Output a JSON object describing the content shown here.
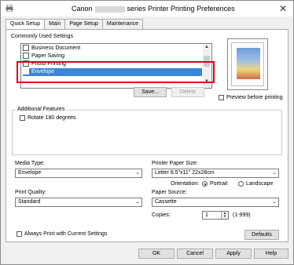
{
  "window": {
    "title_prefix": "Canon",
    "title_suffix": "series Printer Printing Preferences",
    "close": "✕"
  },
  "tabs": [
    {
      "label": "Quick Setup"
    },
    {
      "label": "Main"
    },
    {
      "label": "Page Setup"
    },
    {
      "label": "Maintenance"
    }
  ],
  "commonly_used": {
    "label": "Commonly Used Settings",
    "items": [
      "Business Document",
      "Paper Saving",
      "Photo Printing",
      "Envelope"
    ],
    "selected": "Envelope",
    "save_label": "Save...",
    "delete_label": "Delete"
  },
  "preview": {
    "checkbox_label": "Preview before printing"
  },
  "additional_features": {
    "label": "Additional Features",
    "rotate_label": "Rotate 180 degrees"
  },
  "media_type": {
    "label": "Media Type:",
    "value": "Envelope"
  },
  "printer_paper_size": {
    "label": "Printer Paper Size:",
    "value": "Letter 8.5\"x11\" 22x28cm"
  },
  "orientation": {
    "label": "Orientation:",
    "portrait": "Portrait",
    "landscape": "Landscape"
  },
  "print_quality": {
    "label": "Print Quality:",
    "value": "Standard"
  },
  "paper_source": {
    "label": "Paper Source:",
    "value": "Cassette"
  },
  "copies": {
    "label": "Copies:",
    "value": "1",
    "range": "(1-999)"
  },
  "always_print": {
    "label": "Always Print with Current Settings"
  },
  "defaults_label": "Defaults",
  "footer": {
    "ok": "OK",
    "cancel": "Cancel",
    "apply": "Apply",
    "help": "Help"
  },
  "colors": {
    "selection": "#3a86d8",
    "highlight_border": "#e0001a"
  }
}
